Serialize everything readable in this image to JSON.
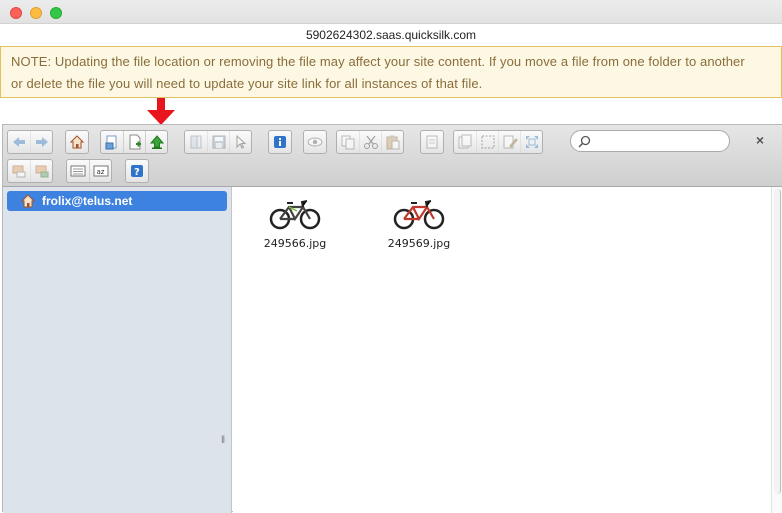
{
  "window": {
    "url": "5902624302.saas.quicksilk.com"
  },
  "notice": {
    "line1": "NOTE: Updating the file location or removing the file may affect your site content. If you move a file from one folder to another",
    "line2": "or delete the file you will need to update your site link for all instances of that file."
  },
  "search": {
    "value": "",
    "clear_label": "×"
  },
  "tree": {
    "root_label": "frolix@telus.net"
  },
  "files": [
    {
      "name": "249566.jpg",
      "accent": "#333333"
    },
    {
      "name": "249569.jpg",
      "accent": "#c0392b"
    }
  ],
  "colors": {
    "note_bg": "#fcf8e3",
    "note_text": "#8a6d3b",
    "selected": "#3e82e0",
    "arrow": "#e8141e"
  }
}
